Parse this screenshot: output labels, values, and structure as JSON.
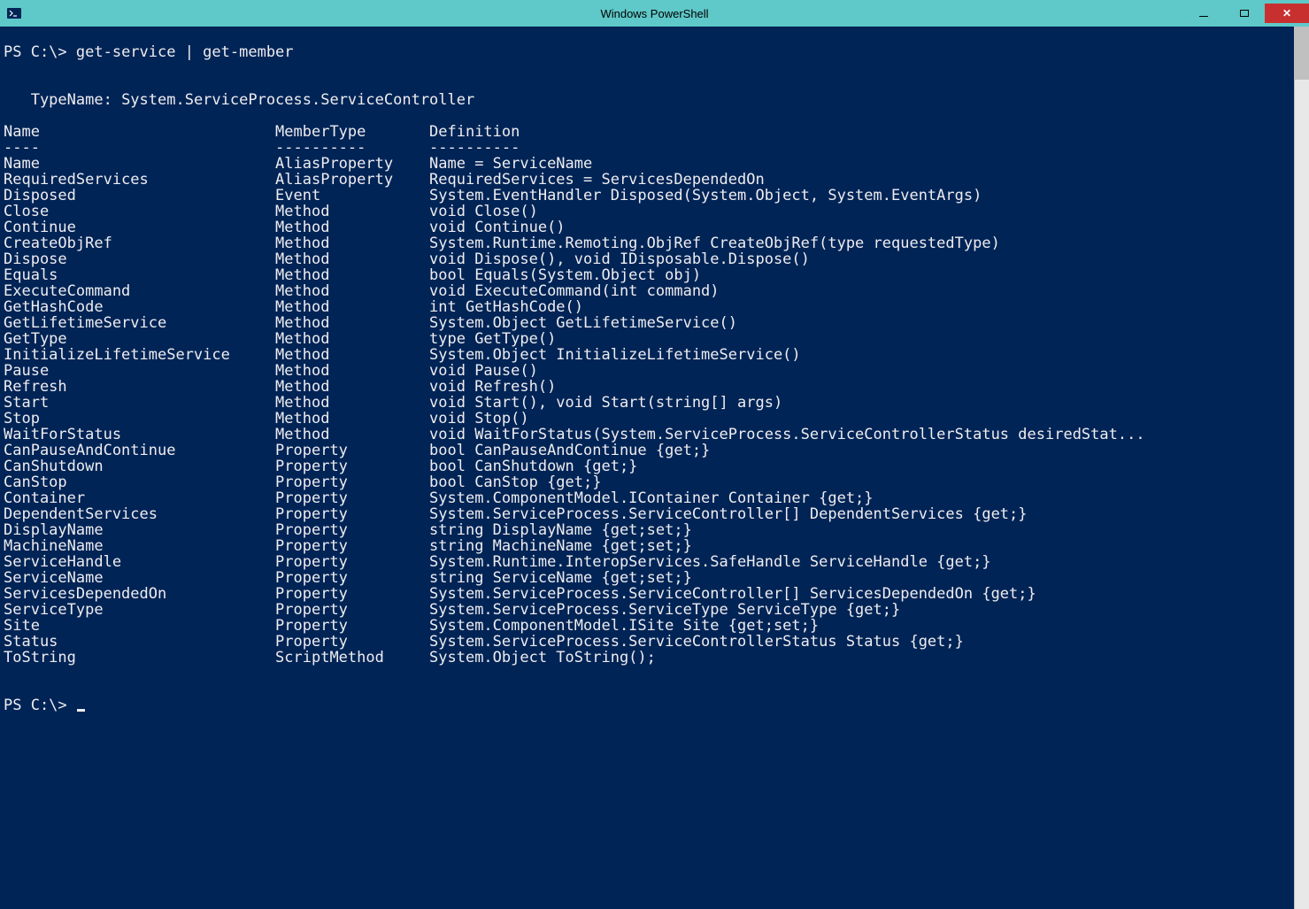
{
  "window": {
    "title": "Windows PowerShell"
  },
  "console": {
    "prompt1": "PS C:\\> ",
    "command": "get-service | get-member",
    "typename_label": "   TypeName: ",
    "typename": "System.ServiceProcess.ServiceController",
    "headers": {
      "name": "Name",
      "type": "MemberType",
      "def": "Definition"
    },
    "dividers": {
      "name": "----",
      "type": "----------",
      "def": "----------"
    },
    "members": [
      {
        "name": "Name",
        "type": "AliasProperty",
        "def": "Name = ServiceName"
      },
      {
        "name": "RequiredServices",
        "type": "AliasProperty",
        "def": "RequiredServices = ServicesDependedOn"
      },
      {
        "name": "Disposed",
        "type": "Event",
        "def": "System.EventHandler Disposed(System.Object, System.EventArgs)"
      },
      {
        "name": "Close",
        "type": "Method",
        "def": "void Close()"
      },
      {
        "name": "Continue",
        "type": "Method",
        "def": "void Continue()"
      },
      {
        "name": "CreateObjRef",
        "type": "Method",
        "def": "System.Runtime.Remoting.ObjRef CreateObjRef(type requestedType)"
      },
      {
        "name": "Dispose",
        "type": "Method",
        "def": "void Dispose(), void IDisposable.Dispose()"
      },
      {
        "name": "Equals",
        "type": "Method",
        "def": "bool Equals(System.Object obj)"
      },
      {
        "name": "ExecuteCommand",
        "type": "Method",
        "def": "void ExecuteCommand(int command)"
      },
      {
        "name": "GetHashCode",
        "type": "Method",
        "def": "int GetHashCode()"
      },
      {
        "name": "GetLifetimeService",
        "type": "Method",
        "def": "System.Object GetLifetimeService()"
      },
      {
        "name": "GetType",
        "type": "Method",
        "def": "type GetType()"
      },
      {
        "name": "InitializeLifetimeService",
        "type": "Method",
        "def": "System.Object InitializeLifetimeService()"
      },
      {
        "name": "Pause",
        "type": "Method",
        "def": "void Pause()"
      },
      {
        "name": "Refresh",
        "type": "Method",
        "def": "void Refresh()"
      },
      {
        "name": "Start",
        "type": "Method",
        "def": "void Start(), void Start(string[] args)"
      },
      {
        "name": "Stop",
        "type": "Method",
        "def": "void Stop()"
      },
      {
        "name": "WaitForStatus",
        "type": "Method",
        "def": "void WaitForStatus(System.ServiceProcess.ServiceControllerStatus desiredStat..."
      },
      {
        "name": "CanPauseAndContinue",
        "type": "Property",
        "def": "bool CanPauseAndContinue {get;}"
      },
      {
        "name": "CanShutdown",
        "type": "Property",
        "def": "bool CanShutdown {get;}"
      },
      {
        "name": "CanStop",
        "type": "Property",
        "def": "bool CanStop {get;}"
      },
      {
        "name": "Container",
        "type": "Property",
        "def": "System.ComponentModel.IContainer Container {get;}"
      },
      {
        "name": "DependentServices",
        "type": "Property",
        "def": "System.ServiceProcess.ServiceController[] DependentServices {get;}"
      },
      {
        "name": "DisplayName",
        "type": "Property",
        "def": "string DisplayName {get;set;}"
      },
      {
        "name": "MachineName",
        "type": "Property",
        "def": "string MachineName {get;set;}"
      },
      {
        "name": "ServiceHandle",
        "type": "Property",
        "def": "System.Runtime.InteropServices.SafeHandle ServiceHandle {get;}"
      },
      {
        "name": "ServiceName",
        "type": "Property",
        "def": "string ServiceName {get;set;}"
      },
      {
        "name": "ServicesDependedOn",
        "type": "Property",
        "def": "System.ServiceProcess.ServiceController[] ServicesDependedOn {get;}"
      },
      {
        "name": "ServiceType",
        "type": "Property",
        "def": "System.ServiceProcess.ServiceType ServiceType {get;}"
      },
      {
        "name": "Site",
        "type": "Property",
        "def": "System.ComponentModel.ISite Site {get;set;}"
      },
      {
        "name": "Status",
        "type": "Property",
        "def": "System.ServiceProcess.ServiceControllerStatus Status {get;}"
      },
      {
        "name": "ToString",
        "type": "ScriptMethod",
        "def": "System.Object ToString();"
      }
    ],
    "prompt2": "PS C:\\> "
  }
}
